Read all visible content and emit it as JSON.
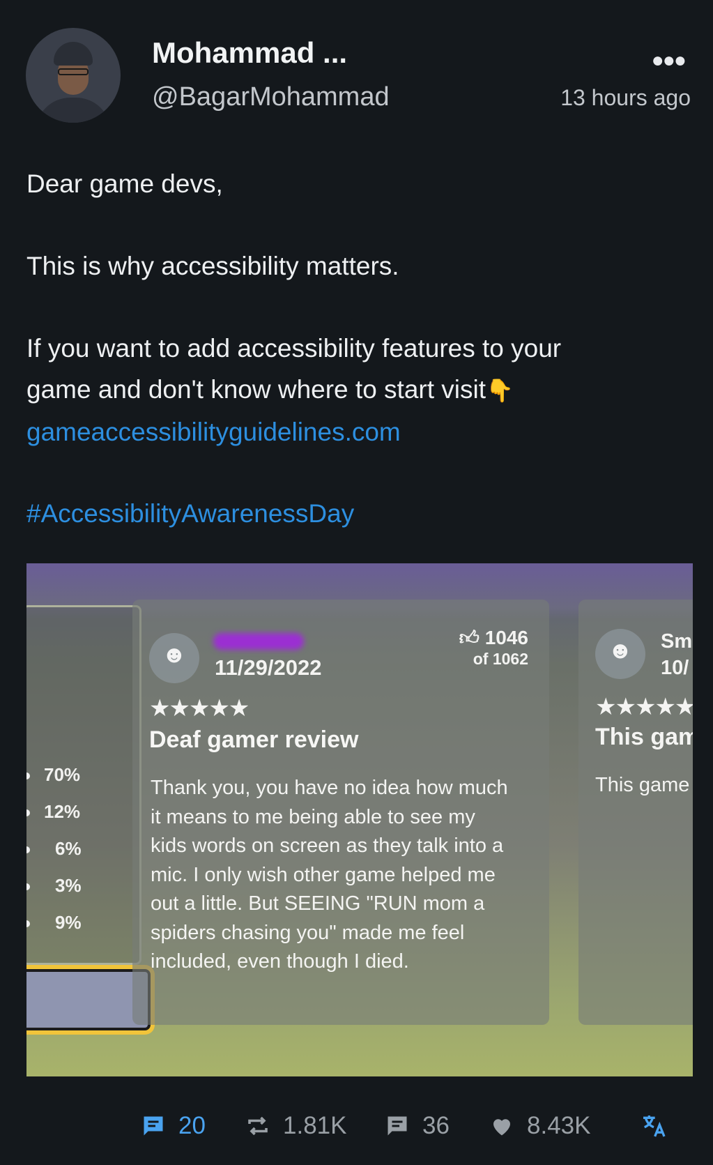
{
  "post": {
    "author_name": "Mohammad ...",
    "author_handle": "@BagarMohammad",
    "timestamp": "13 hours ago",
    "more_icon": "more-options-icon",
    "line1": "Dear game devs,",
    "line2": "This is why accessibility matters.",
    "line3a": "If you want to add accessibility features to your",
    "line3b": "game and don't know where to start visit",
    "pointer_emoji": "👇",
    "link": "gameaccessibilityguidelines.com",
    "hashtag": "#AccessibilityAwarenessDay"
  },
  "media": {
    "left_panel_percentages": [
      "70%",
      "12%",
      "6%",
      "3%",
      "9%"
    ],
    "review": {
      "date": "11/29/2022",
      "likes": "1046",
      "likes_of": "of 1062",
      "stars": "★★★★★",
      "title": "Deaf gamer review",
      "body": "Thank you, you have no idea how much it means to me being able to see my kids words on screen as they talk into a mic. I only wish other game helped me out a little. But SEEING \"RUN mom a spiders chasing you\" made me feel included, even though I died."
    },
    "review2": {
      "name_partial": "Sm",
      "date_partial": "10/",
      "stars": "★★★★★",
      "title_partial": "This gam",
      "body_partial": "This game"
    }
  },
  "actions": {
    "comments": "20",
    "reposts": "1.81K",
    "quotes": "36",
    "likes": "8.43K"
  },
  "colors": {
    "background": "#14181c",
    "link": "#2d8fe0",
    "action_active": "#4aa3f0",
    "action": "#9aa0a6"
  }
}
